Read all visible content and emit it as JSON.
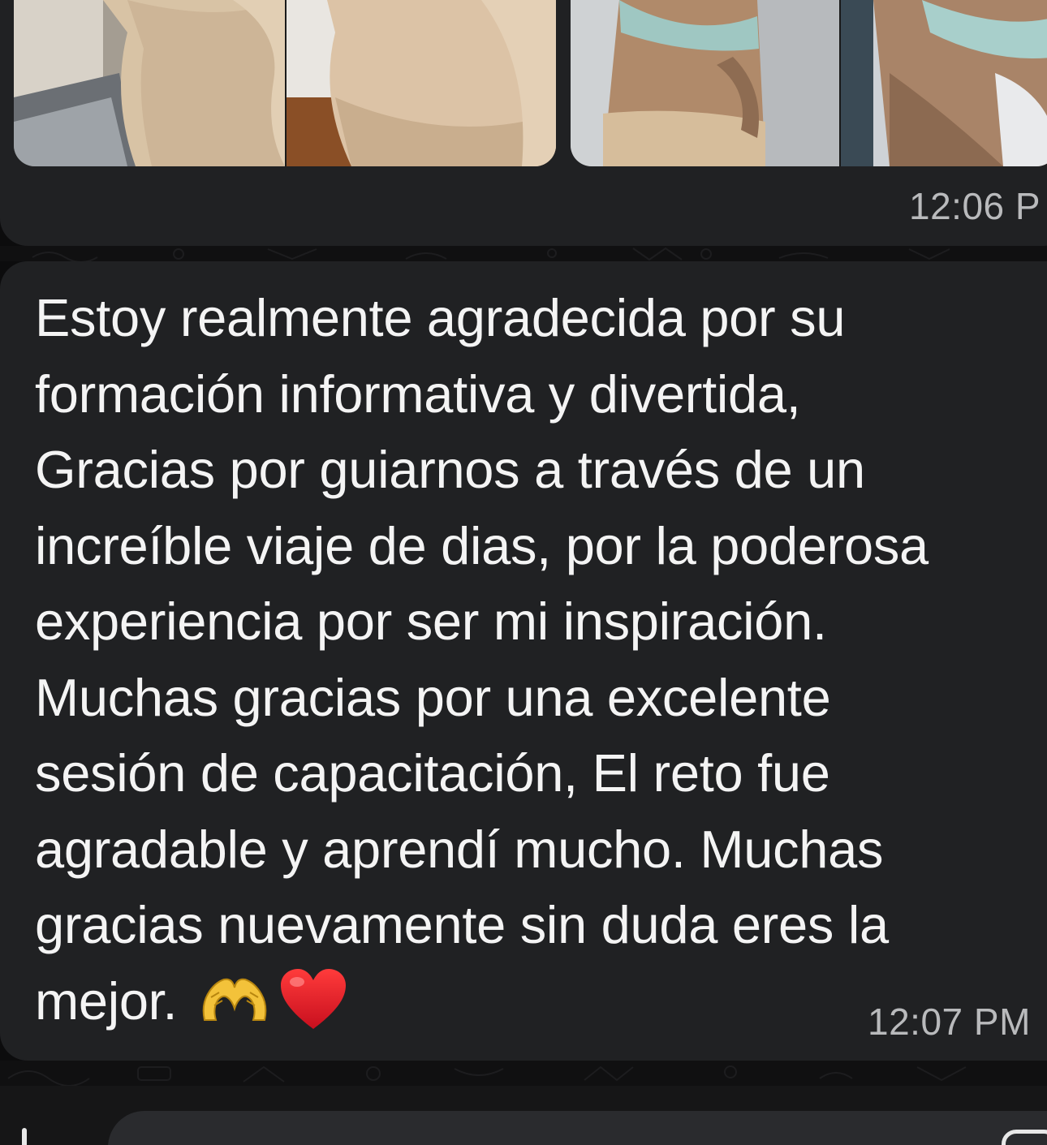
{
  "messages": [
    {
      "type": "image-album",
      "time": "12:06 P",
      "photos": [
        "photo-1",
        "photo-2",
        "photo-3",
        "photo-4"
      ]
    },
    {
      "type": "text",
      "text": "Estoy realmente agradecida por su\nformación informativa y divertida,\nGracias por guiarnos a través de un\nincreíble viaje de dias, por la poderosa\nexperiencia por ser mi inspiración.\nMuchas gracias por una excelente\nsesión de capacitación, El reto fue\nagradable y aprendí mucho. Muchas\ngracias nuevamente sin duda eres la\nmejor.",
      "emojis": [
        "heart-hands-emoji",
        "red-heart-emoji"
      ],
      "time": "12:07 PM"
    }
  ],
  "composer": {
    "attach_icon": "plus-icon",
    "sticker_icon": "sticker-icon"
  },
  "colors": {
    "background": "#0c0c0d",
    "bubble": "#202123",
    "text": "#f4f4f4",
    "timestamp": "#b9babc"
  }
}
